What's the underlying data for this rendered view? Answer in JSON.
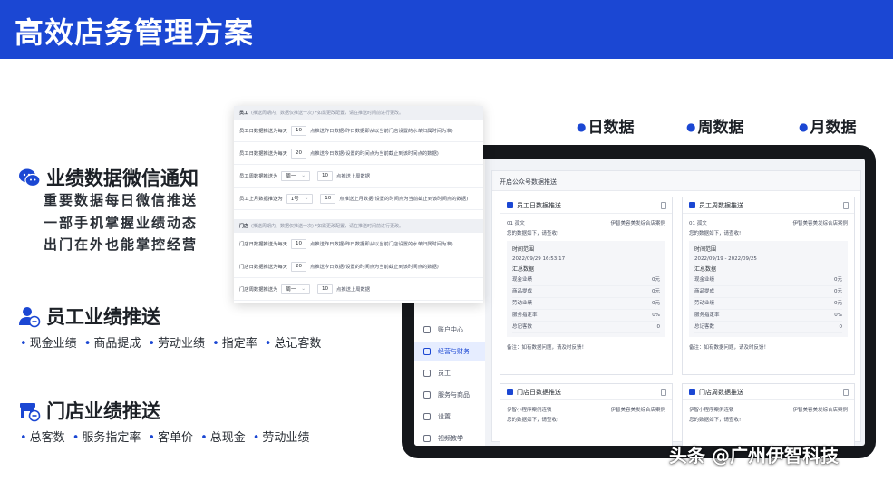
{
  "banner": {
    "title": "高效店务管理方案"
  },
  "legend": {
    "day": "日数据",
    "week": "周数据",
    "month": "月数据"
  },
  "wechat": {
    "title": "业绩数据微信通知",
    "lines": [
      "重要数据每日微信推送",
      "一部手机掌握业绩动态",
      "出门在外也能掌控经营"
    ]
  },
  "staff": {
    "title": "员工业绩推送",
    "tags": [
      "现金业绩",
      "商品提成",
      "劳动业绩",
      "指定率",
      "总记客数"
    ]
  },
  "store": {
    "title": "门店业绩推送",
    "tags": [
      "总客数",
      "服务指定率",
      "客单价",
      "总现金",
      "劳动业绩"
    ]
  },
  "panel": {
    "staff_head": "员工",
    "staff_head_note": "(推送周期内，数据仅推送一次)   *如需更改配置，请在推送时间前进行更改。",
    "staff_rows": [
      {
        "label": "员工日数据推送为每天",
        "value": "10",
        "tail": "点推送昨日数据(昨日数据即从以当前门店设置的水单归属时间为准)"
      },
      {
        "label": "员工日数据推送为每天",
        "value": "20",
        "tail": "点推送今日数据(设置的时间点为当前截止到该时间点的数据)"
      },
      {
        "label": "员工周数据推送为",
        "select": "周一",
        "value": "10",
        "tail": "点推送上周数据"
      },
      {
        "label": "员工上月数据推送为",
        "select": "1号",
        "value": "10",
        "tail": "点推送上月数据(设置的时间点为当前截止到该时间点的数据)"
      }
    ],
    "store_head": "门店",
    "store_head_note": "(推送周期内，数据仅推送一次)   *如需更改配置，请在推送时间前进行更改。",
    "store_rows": [
      {
        "label": "门店日数据推送为每天",
        "value": "10",
        "tail": "点推送昨日数据(昨日数据即从以当前门店设置的水单归属时间为准)"
      },
      {
        "label": "门店日数据推送为每天",
        "value": "20",
        "tail": "点推送今日数据(设置的时间点为当前截止到该时间点的数据)"
      },
      {
        "label": "门店周数据推送为",
        "select": "周一",
        "value": "10",
        "tail": "点推送上周数据"
      }
    ]
  },
  "screen": {
    "header": "开启公众号数据推送",
    "sidebar": [
      "账户中心",
      "经营与财务",
      "员工",
      "服务与商品",
      "设置",
      "视频教学"
    ],
    "card_staff_day": {
      "title": "员工日数据推送",
      "meta_left": "01 孤文",
      "meta_right": "伊智美容美发综合店案例",
      "greet": "您的数据如下，请查收!",
      "range_label": "时间范围",
      "range": "2022/09/29 16:53:17",
      "sum_label": "汇总数据",
      "kv": [
        [
          "现金业绩",
          "0元"
        ],
        [
          "商品提成",
          "0元"
        ],
        [
          "劳动业绩",
          "0元"
        ],
        [
          "服务指定率",
          "0%"
        ],
        [
          "总记客数",
          "0"
        ]
      ],
      "note": "备注：如有数据问题，请及时反馈！"
    },
    "card_staff_week": {
      "title": "员工周数据推送",
      "meta_left": "01 孤文",
      "meta_right": "伊智美容美发综合店案例",
      "greet": "您的数据如下，请查收!",
      "range_label": "时间范围",
      "range": "2022/09/19 - 2022/09/25",
      "sum_label": "汇总数据",
      "kv": [
        [
          "现金业绩",
          "0元"
        ],
        [
          "商品提成",
          "0元"
        ],
        [
          "劳动业绩",
          "0元"
        ],
        [
          "服务指定率",
          "0%"
        ],
        [
          "总记客数",
          "0"
        ]
      ],
      "note": "备注：如有数据问题，请及时反馈！"
    },
    "card_store_day": {
      "title": "门店日数据推送",
      "meta_left": "伊智小程序案例连锁",
      "meta_right": "伊智美容美发综合店案例",
      "greet": "您的数据如下，请查收!"
    },
    "card_store_week": {
      "title": "门店周数据推送",
      "meta_left": "伊智小程序案例连锁",
      "meta_right": "伊智美容美发综合店案例",
      "greet": "您的数据如下，请查收!"
    }
  },
  "watermark": "头条 @广州伊智科技",
  "colors": {
    "brand": "#1b47d3",
    "device": "#15171b"
  }
}
